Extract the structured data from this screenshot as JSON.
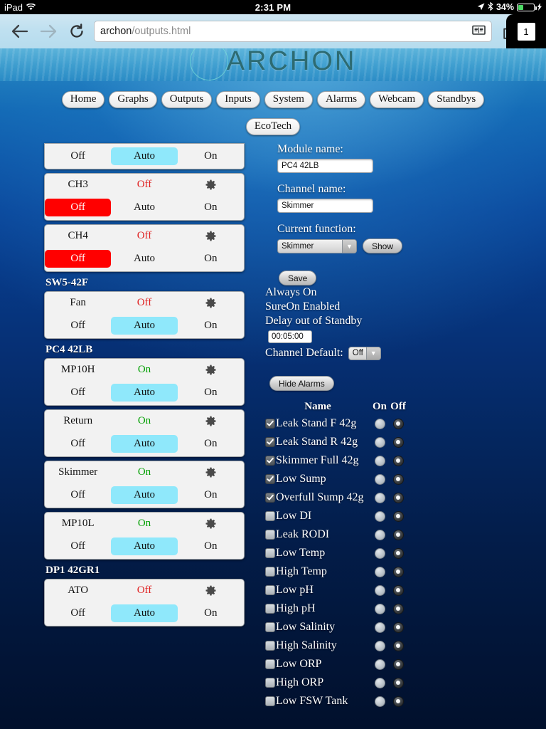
{
  "status_bar": {
    "device": "iPad",
    "wifi_icon": "wifi-icon",
    "time": "2:31 PM",
    "location_icon": "location-arrow-icon",
    "bluetooth_icon": "bluetooth-icon",
    "battery_percent": "34%",
    "charging_icon": "lightning-bolt-icon"
  },
  "browser": {
    "back_icon": "back-arrow-icon",
    "forward_icon": "forward-arrow-icon",
    "reload_icon": "reload-icon",
    "url_host": "archon",
    "url_path": "/outputs.html",
    "reader_icon": "reader-view-icon",
    "share_icon": "share-icon",
    "bookmark_icon": "star-icon",
    "tab_count": "1"
  },
  "site": {
    "logo_text": "ARCHON",
    "nav_primary": [
      {
        "label": "Home"
      },
      {
        "label": "Graphs"
      },
      {
        "label": "Outputs"
      },
      {
        "label": "Inputs"
      },
      {
        "label": "System"
      },
      {
        "label": "Alarms"
      },
      {
        "label": "Webcam"
      },
      {
        "label": "Standbys"
      }
    ],
    "nav_secondary": [
      {
        "label": "EcoTech"
      }
    ]
  },
  "outputs": {
    "mode_labels": {
      "off": "Off",
      "auto": "Auto",
      "on": "On"
    },
    "gear_icon": "gear-icon",
    "groups": [
      {
        "module": null,
        "channels": [
          {
            "name": "",
            "state": "",
            "state_kind": "none",
            "mode": "auto",
            "clipped_top": true
          }
        ]
      },
      {
        "module": null,
        "channels": [
          {
            "name": "CH3",
            "state": "Off",
            "state_kind": "off",
            "mode": "off",
            "clipped_top": false
          },
          {
            "name": "CH4",
            "state": "Off",
            "state_kind": "off",
            "mode": "off",
            "clipped_top": false
          }
        ]
      },
      {
        "module": "SW5-42F",
        "channels": [
          {
            "name": "Fan",
            "state": "Off",
            "state_kind": "off",
            "mode": "auto",
            "clipped_top": false
          }
        ]
      },
      {
        "module": "PC4 42LB",
        "channels": [
          {
            "name": "MP10H",
            "state": "On",
            "state_kind": "on",
            "mode": "auto",
            "clipped_top": false
          },
          {
            "name": "Return",
            "state": "On",
            "state_kind": "on",
            "mode": "auto",
            "clipped_top": false
          },
          {
            "name": "Skimmer",
            "state": "On",
            "state_kind": "on",
            "mode": "auto",
            "clipped_top": false
          },
          {
            "name": "MP10L",
            "state": "On",
            "state_kind": "on",
            "mode": "auto",
            "clipped_top": false
          }
        ]
      },
      {
        "module": "DP1 42GR1",
        "channels": [
          {
            "name": "ATO",
            "state": "Off",
            "state_kind": "off",
            "mode": "auto",
            "clipped_top": false
          }
        ]
      }
    ]
  },
  "detail": {
    "module_name_label": "Module name:",
    "module_name_value": "PC4 42LB",
    "channel_name_label": "Channel name:",
    "channel_name_value": "Skimmer",
    "current_function_label": "Current function:",
    "current_function_value": "Skimmer",
    "show_button": "Show",
    "save_button": "Save",
    "always_on": "Always On",
    "sureon_enabled": "SureOn Enabled",
    "delay_label": "Delay out of Standby",
    "delay_value": "00:05:00",
    "channel_default_label": "Channel Default:",
    "channel_default_value": "Off",
    "hide_alarms_button": "Hide Alarms"
  },
  "alarms": {
    "header": {
      "name": "Name",
      "on": "On",
      "off": "Off"
    },
    "rows": [
      {
        "name": "Leak Stand F 42g",
        "checked": true,
        "selected": "off"
      },
      {
        "name": "Leak Stand R 42g",
        "checked": true,
        "selected": "off"
      },
      {
        "name": "Skimmer Full 42g",
        "checked": true,
        "selected": "off"
      },
      {
        "name": "Low Sump",
        "checked": true,
        "selected": "off"
      },
      {
        "name": "Overfull Sump 42g",
        "checked": true,
        "selected": "off"
      },
      {
        "name": "Low DI",
        "checked": false,
        "selected": "off"
      },
      {
        "name": "Leak RODI",
        "checked": false,
        "selected": "off"
      },
      {
        "name": "Low Temp",
        "checked": false,
        "selected": "off"
      },
      {
        "name": "High Temp",
        "checked": false,
        "selected": "off"
      },
      {
        "name": "Low pH",
        "checked": false,
        "selected": "off"
      },
      {
        "name": "High pH",
        "checked": false,
        "selected": "off"
      },
      {
        "name": "Low Salinity",
        "checked": false,
        "selected": "off"
      },
      {
        "name": "High Salinity",
        "checked": false,
        "selected": "off"
      },
      {
        "name": "Low ORP",
        "checked": false,
        "selected": "off"
      },
      {
        "name": "High ORP",
        "checked": false,
        "selected": "off"
      },
      {
        "name": "Low FSW Tank",
        "checked": false,
        "selected": "off"
      }
    ]
  },
  "colors": {
    "auto_selected": "#8fe8fb",
    "off_selected": "#ff0000",
    "state_on": "#00a000",
    "state_off": "#e02020",
    "logo": "#2d6b72"
  }
}
